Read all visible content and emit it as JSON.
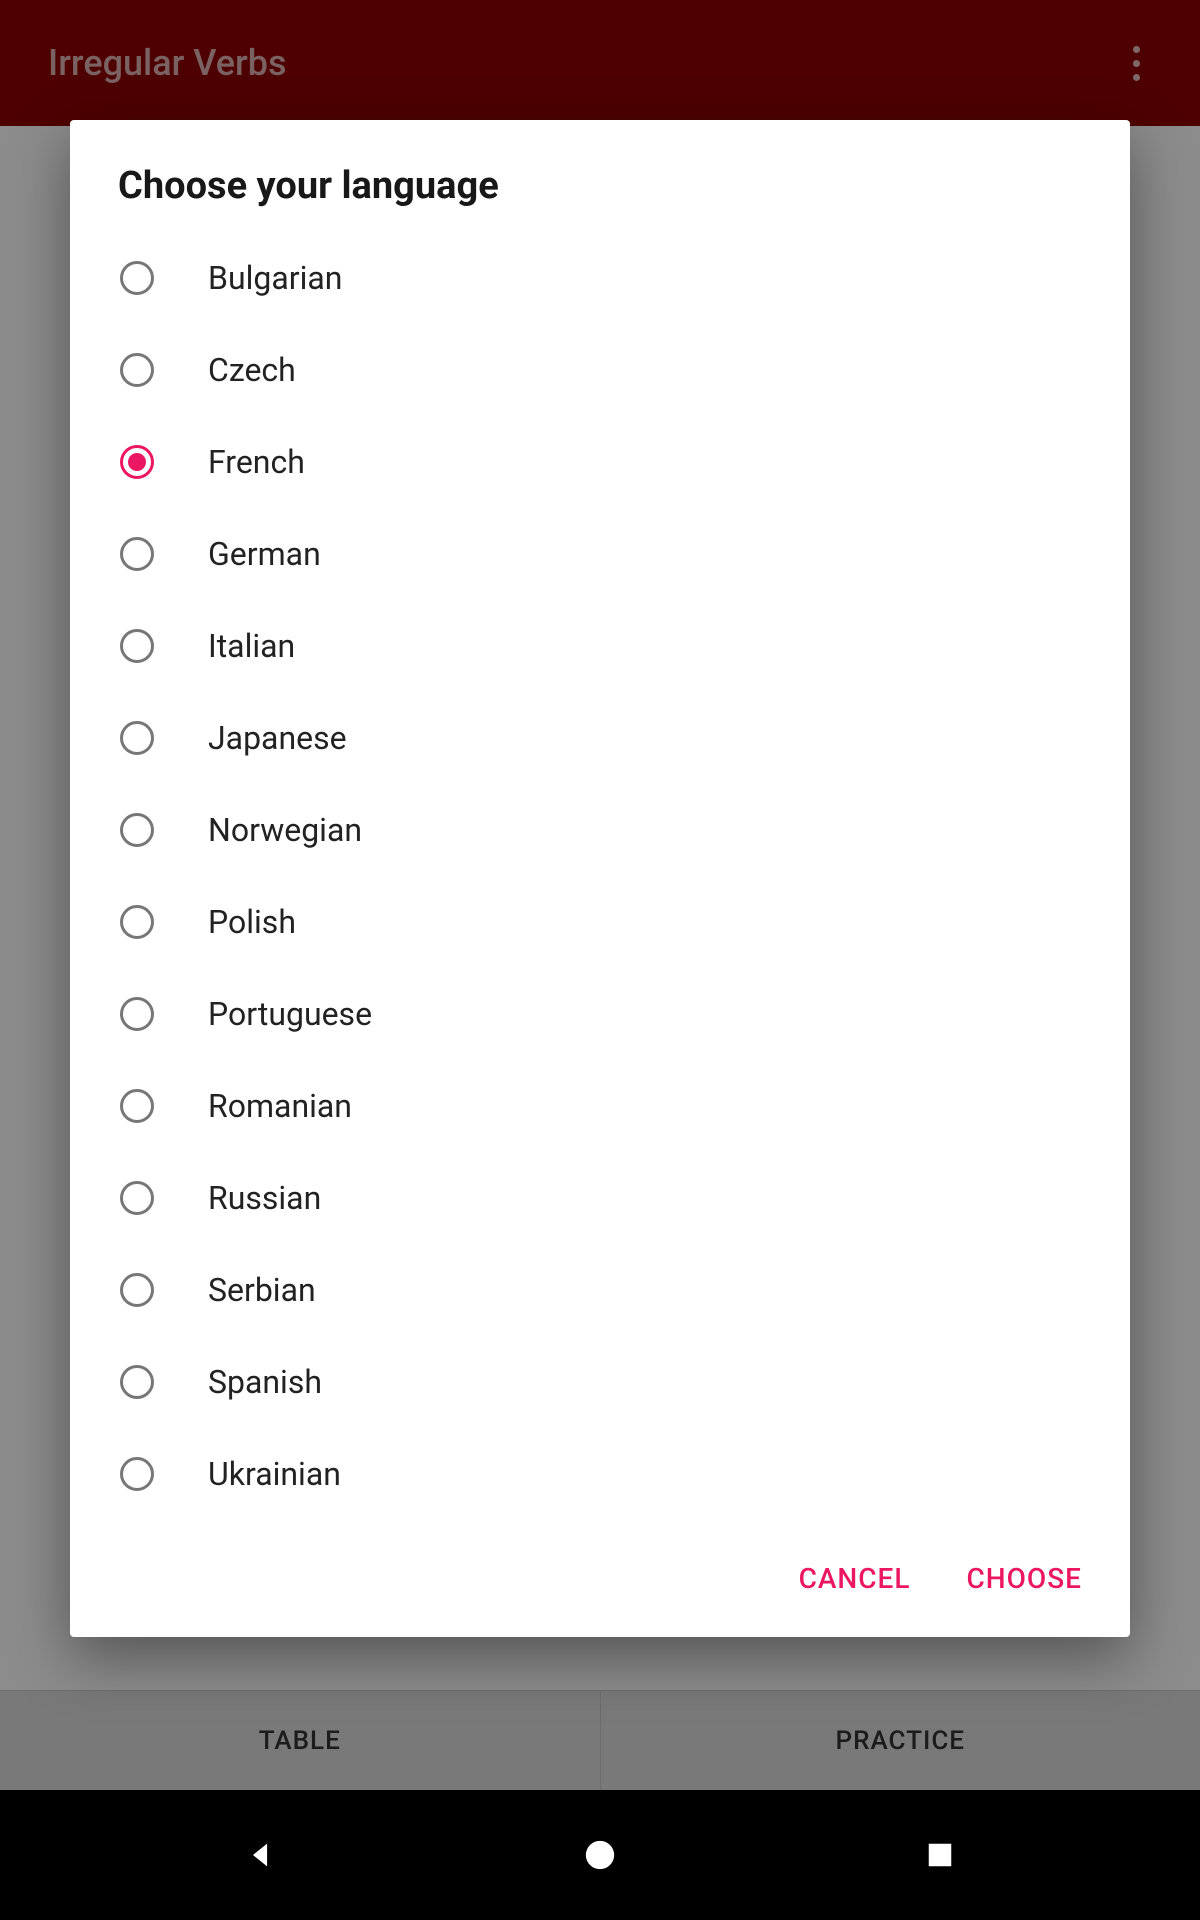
{
  "colors": {
    "app_bar": "#8f0000",
    "accent": "#ec1762"
  },
  "header": {
    "title": "Irregular Verbs"
  },
  "tabs": {
    "table": "TABLE",
    "practice": "PRACTICE"
  },
  "dialog": {
    "title": "Choose your language",
    "selected_index": 2,
    "languages": [
      "Bulgarian",
      "Czech",
      "French",
      "German",
      "Italian",
      "Japanese",
      "Norwegian",
      "Polish",
      "Portuguese",
      "Romanian",
      "Russian",
      "Serbian",
      "Spanish",
      "Ukrainian"
    ],
    "actions": {
      "cancel": "CANCEL",
      "choose": "CHOOSE"
    }
  }
}
